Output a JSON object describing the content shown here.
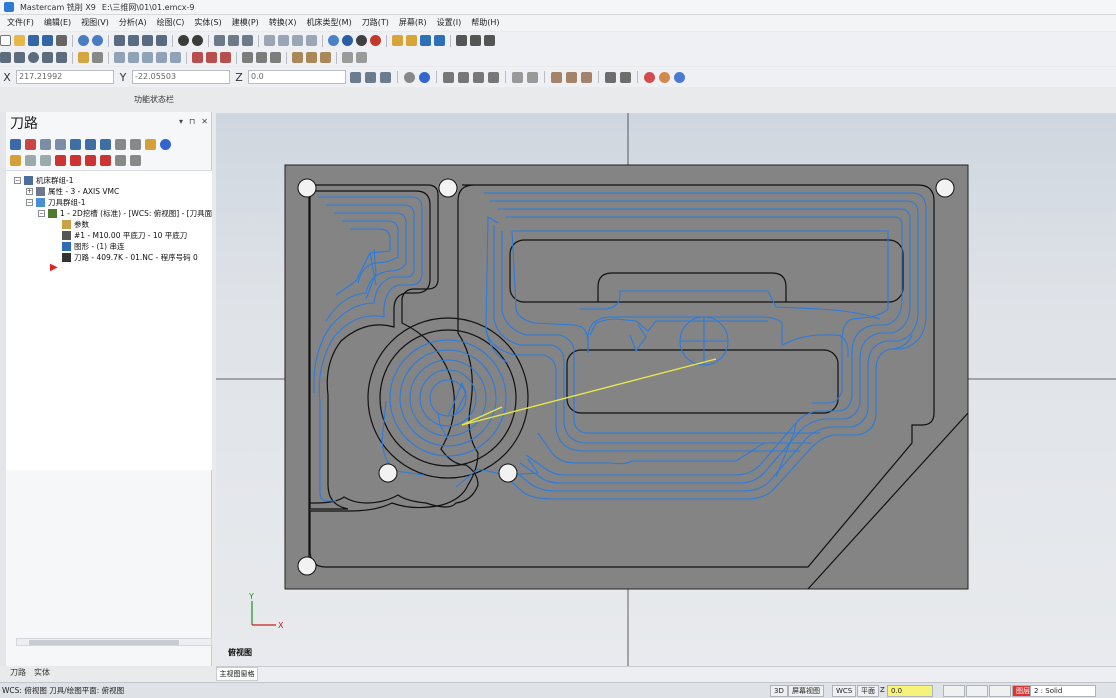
{
  "window": {
    "title": "Mastercam 铣削 X9",
    "file_path": "E:\\三维网\\01\\01.emcx-9"
  },
  "menu": [
    "文件(F)",
    "编辑(E)",
    "视图(V)",
    "分析(A)",
    "绘图(C)",
    "实体(S)",
    "建模(P)",
    "转换(X)",
    "机床类型(M)",
    "刀路(T)",
    "屏幕(R)",
    "设置(I)",
    "帮助(H)"
  ],
  "coords": {
    "x_label": "X",
    "x_value": "217.21992",
    "y_label": "Y",
    "y_value": "-22.05503",
    "z_label": "Z",
    "z_value": "0.0"
  },
  "function_status": "功能状态栏",
  "panel": {
    "title": "刀路",
    "tree": [
      {
        "text": "机床群组-1"
      },
      {
        "text": "属性 - 3 - AXIS VMC"
      },
      {
        "text": "刀具群组-1"
      },
      {
        "text": "1 - 2D挖槽 (标准) - [WCS: 俯视图] - [刀具面"
      },
      {
        "text": "参数"
      },
      {
        "text": "#1 - M10.00 平底刀 - 10 平底刀"
      },
      {
        "text": "图形 - (1) 串连"
      },
      {
        "text": "刀路 - 409.7K - 01.NC - 程序号码 0"
      }
    ],
    "tabs": [
      "刀路",
      "实体"
    ]
  },
  "viewport": {
    "view_name": "俯视图",
    "tab": "主视图窗格"
  },
  "status": {
    "left": "WCS: 俯视图 刀具/绘图平面: 俯视图",
    "items": [
      "3D",
      "屏幕视图",
      "WCS",
      "平面",
      "Z",
      "0.0",
      "图层",
      "2 : Solid"
    ]
  },
  "colors": {
    "toolpath": "#2a7be0",
    "stock": "#838383",
    "chain": "#111111",
    "rapid": "#e7e84a"
  }
}
